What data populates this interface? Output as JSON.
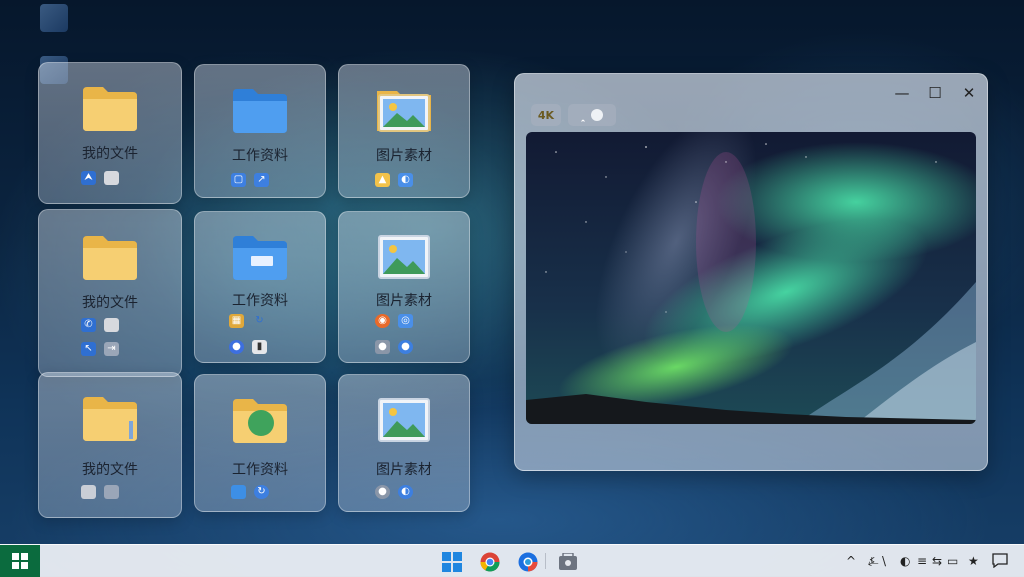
{
  "cards": [
    {
      "label": "我的文件"
    },
    {
      "label": "工作资料"
    },
    {
      "label": "图片素材"
    },
    {
      "label": "我的文件"
    },
    {
      "label": "工作资料"
    },
    {
      "label": "图片素材"
    },
    {
      "label": "我的文件"
    },
    {
      "label": "工作资料"
    },
    {
      "label": "图片素材"
    }
  ],
  "viewer": {
    "chip_resolution": "4K",
    "minimize_glyph": "—",
    "maximize_glyph": "☐",
    "close_glyph": "✕"
  },
  "taskbar": {
    "tray": {
      "chevron": "^",
      "star": "★"
    }
  },
  "colors": {
    "folder_yellow": "#f3c764",
    "folder_blue": "#3d8fe6",
    "start_green": "#0b6b3e"
  },
  "icons": [
    "folder-yellow-icon",
    "folder-blue-icon",
    "image-icon",
    "windows-start-icon",
    "chrome-icon",
    "store-icon",
    "notification-icon"
  ]
}
